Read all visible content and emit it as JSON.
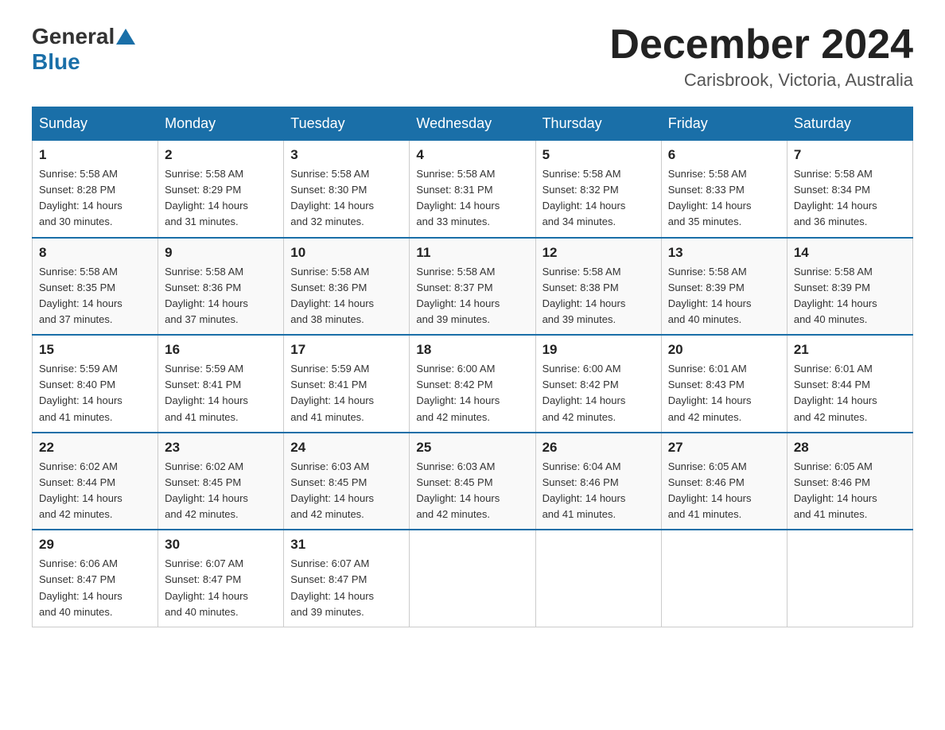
{
  "header": {
    "logo_general": "General",
    "logo_blue": "Blue",
    "month_title": "December 2024",
    "location": "Carisbrook, Victoria, Australia"
  },
  "days_of_week": [
    "Sunday",
    "Monday",
    "Tuesday",
    "Wednesday",
    "Thursday",
    "Friday",
    "Saturday"
  ],
  "weeks": [
    [
      {
        "day": "1",
        "sunrise": "5:58 AM",
        "sunset": "8:28 PM",
        "daylight": "14 hours and 30 minutes."
      },
      {
        "day": "2",
        "sunrise": "5:58 AM",
        "sunset": "8:29 PM",
        "daylight": "14 hours and 31 minutes."
      },
      {
        "day": "3",
        "sunrise": "5:58 AM",
        "sunset": "8:30 PM",
        "daylight": "14 hours and 32 minutes."
      },
      {
        "day": "4",
        "sunrise": "5:58 AM",
        "sunset": "8:31 PM",
        "daylight": "14 hours and 33 minutes."
      },
      {
        "day": "5",
        "sunrise": "5:58 AM",
        "sunset": "8:32 PM",
        "daylight": "14 hours and 34 minutes."
      },
      {
        "day": "6",
        "sunrise": "5:58 AM",
        "sunset": "8:33 PM",
        "daylight": "14 hours and 35 minutes."
      },
      {
        "day": "7",
        "sunrise": "5:58 AM",
        "sunset": "8:34 PM",
        "daylight": "14 hours and 36 minutes."
      }
    ],
    [
      {
        "day": "8",
        "sunrise": "5:58 AM",
        "sunset": "8:35 PM",
        "daylight": "14 hours and 37 minutes."
      },
      {
        "day": "9",
        "sunrise": "5:58 AM",
        "sunset": "8:36 PM",
        "daylight": "14 hours and 37 minutes."
      },
      {
        "day": "10",
        "sunrise": "5:58 AM",
        "sunset": "8:36 PM",
        "daylight": "14 hours and 38 minutes."
      },
      {
        "day": "11",
        "sunrise": "5:58 AM",
        "sunset": "8:37 PM",
        "daylight": "14 hours and 39 minutes."
      },
      {
        "day": "12",
        "sunrise": "5:58 AM",
        "sunset": "8:38 PM",
        "daylight": "14 hours and 39 minutes."
      },
      {
        "day": "13",
        "sunrise": "5:58 AM",
        "sunset": "8:39 PM",
        "daylight": "14 hours and 40 minutes."
      },
      {
        "day": "14",
        "sunrise": "5:58 AM",
        "sunset": "8:39 PM",
        "daylight": "14 hours and 40 minutes."
      }
    ],
    [
      {
        "day": "15",
        "sunrise": "5:59 AM",
        "sunset": "8:40 PM",
        "daylight": "14 hours and 41 minutes."
      },
      {
        "day": "16",
        "sunrise": "5:59 AM",
        "sunset": "8:41 PM",
        "daylight": "14 hours and 41 minutes."
      },
      {
        "day": "17",
        "sunrise": "5:59 AM",
        "sunset": "8:41 PM",
        "daylight": "14 hours and 41 minutes."
      },
      {
        "day": "18",
        "sunrise": "6:00 AM",
        "sunset": "8:42 PM",
        "daylight": "14 hours and 42 minutes."
      },
      {
        "day": "19",
        "sunrise": "6:00 AM",
        "sunset": "8:42 PM",
        "daylight": "14 hours and 42 minutes."
      },
      {
        "day": "20",
        "sunrise": "6:01 AM",
        "sunset": "8:43 PM",
        "daylight": "14 hours and 42 minutes."
      },
      {
        "day": "21",
        "sunrise": "6:01 AM",
        "sunset": "8:44 PM",
        "daylight": "14 hours and 42 minutes."
      }
    ],
    [
      {
        "day": "22",
        "sunrise": "6:02 AM",
        "sunset": "8:44 PM",
        "daylight": "14 hours and 42 minutes."
      },
      {
        "day": "23",
        "sunrise": "6:02 AM",
        "sunset": "8:45 PM",
        "daylight": "14 hours and 42 minutes."
      },
      {
        "day": "24",
        "sunrise": "6:03 AM",
        "sunset": "8:45 PM",
        "daylight": "14 hours and 42 minutes."
      },
      {
        "day": "25",
        "sunrise": "6:03 AM",
        "sunset": "8:45 PM",
        "daylight": "14 hours and 42 minutes."
      },
      {
        "day": "26",
        "sunrise": "6:04 AM",
        "sunset": "8:46 PM",
        "daylight": "14 hours and 41 minutes."
      },
      {
        "day": "27",
        "sunrise": "6:05 AM",
        "sunset": "8:46 PM",
        "daylight": "14 hours and 41 minutes."
      },
      {
        "day": "28",
        "sunrise": "6:05 AM",
        "sunset": "8:46 PM",
        "daylight": "14 hours and 41 minutes."
      }
    ],
    [
      {
        "day": "29",
        "sunrise": "6:06 AM",
        "sunset": "8:47 PM",
        "daylight": "14 hours and 40 minutes."
      },
      {
        "day": "30",
        "sunrise": "6:07 AM",
        "sunset": "8:47 PM",
        "daylight": "14 hours and 40 minutes."
      },
      {
        "day": "31",
        "sunrise": "6:07 AM",
        "sunset": "8:47 PM",
        "daylight": "14 hours and 39 minutes."
      },
      null,
      null,
      null,
      null
    ]
  ],
  "labels": {
    "sunrise": "Sunrise:",
    "sunset": "Sunset:",
    "daylight": "Daylight:"
  }
}
